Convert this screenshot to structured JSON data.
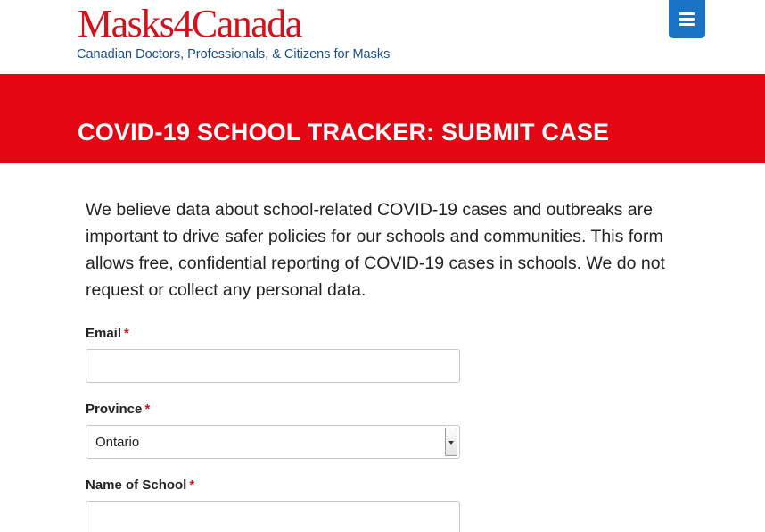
{
  "header": {
    "logo_text": "Masks4Canada",
    "tagline": "Canadian Doctors, Professionals, & Citizens for Masks",
    "menu_icon": "hamburger-menu-icon"
  },
  "colors": {
    "brand_red": "#e30613",
    "logo_red": "#d5121b",
    "tagline_blue": "#1a4f8b",
    "menu_blue": "#1a73c4"
  },
  "banner": {
    "title": "COVID-19 SCHOOL TRACKER: SUBMIT CASE"
  },
  "intro": "We believe data about school-related COVID-19 cases and outbreaks are important to drive safer policies for our schools and communities. This form allows free, confidential reporting of COVID-19 cases in schools. We do not request or collect any personal data.",
  "form": {
    "email": {
      "label": "Email",
      "required_mark": "*",
      "value": ""
    },
    "province": {
      "label": "Province",
      "required_mark": "*",
      "selected": "Ontario"
    },
    "school": {
      "label": "Name of School",
      "required_mark": "*",
      "value": ""
    }
  }
}
